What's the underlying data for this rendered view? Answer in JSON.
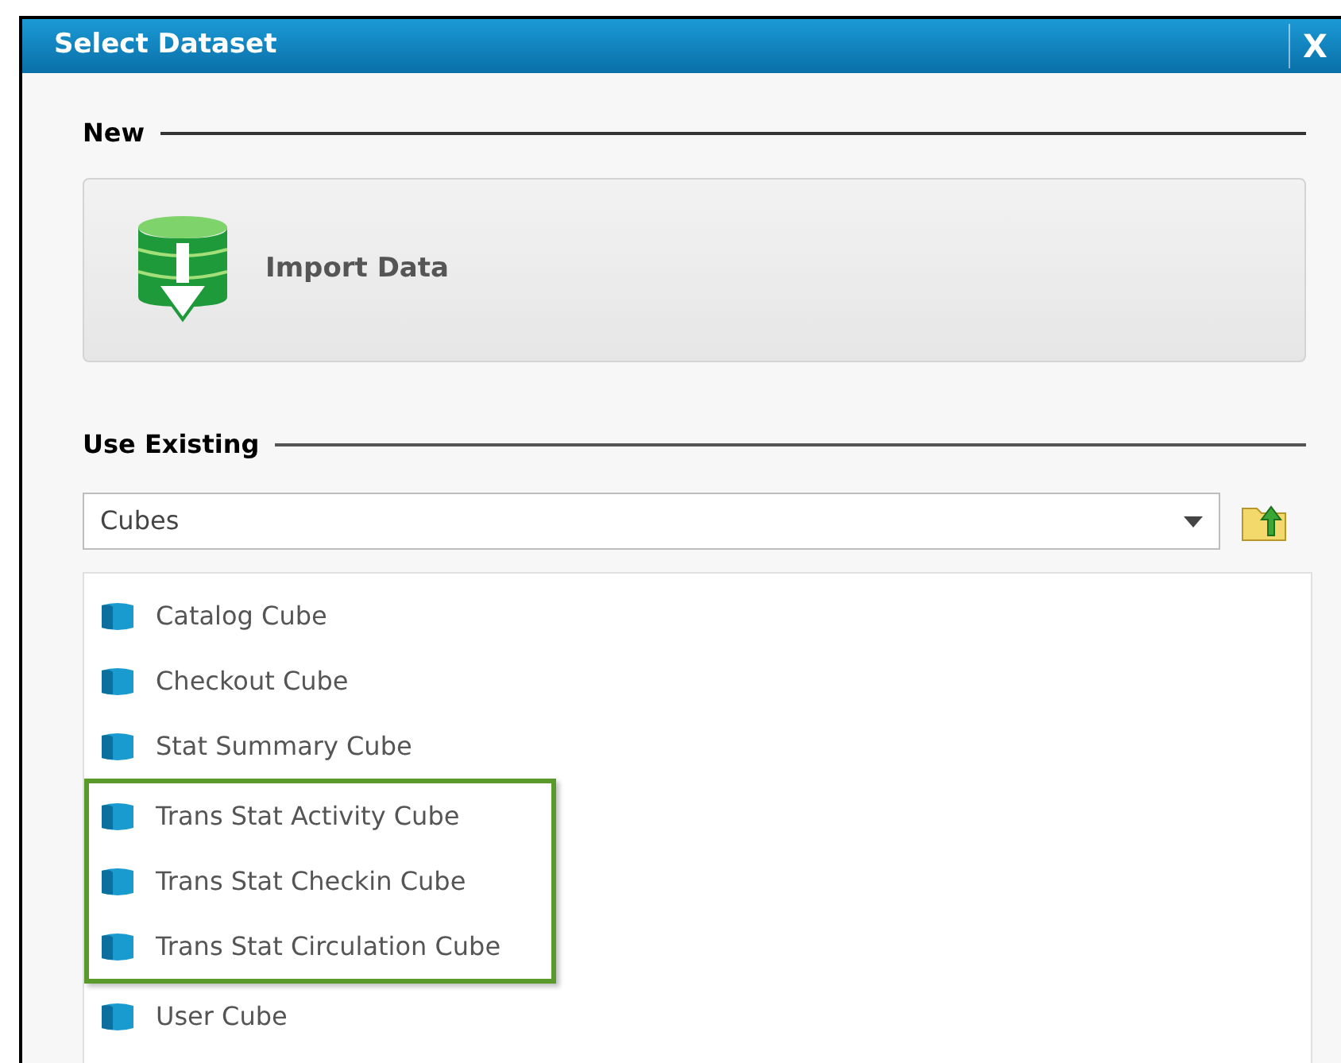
{
  "window": {
    "title": "Select Dataset",
    "close": "X"
  },
  "new_section": {
    "heading": "New",
    "button": "Import Data"
  },
  "existing_section": {
    "heading": "Use Existing",
    "dropdown": {
      "value": "Cubes"
    }
  },
  "items": [
    {
      "label": "Catalog Cube",
      "highlighted": false
    },
    {
      "label": "Checkout Cube",
      "highlighted": false
    },
    {
      "label": "Stat Summary Cube",
      "highlighted": false
    },
    {
      "label": "Trans Stat Activity Cube",
      "highlighted": true
    },
    {
      "label": "Trans Stat Checkin Cube",
      "highlighted": true
    },
    {
      "label": "Trans Stat Circulation Cube",
      "highlighted": true
    },
    {
      "label": "User Cube",
      "highlighted": false
    }
  ]
}
